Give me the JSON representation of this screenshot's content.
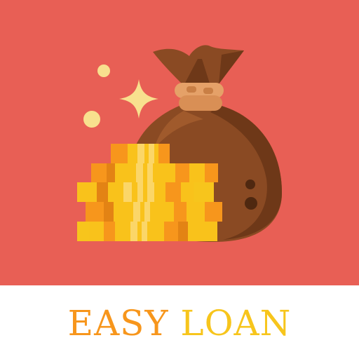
{
  "brand": {
    "word_easy": "EASY",
    "word_loan": "LOAN"
  },
  "colors": {
    "background": "#e85f55",
    "footer_background": "#ffffff",
    "title_easy": "#f7961c",
    "title_loan": "#f7c51c",
    "bag": "#8a4a23",
    "bag_shadow": "#6e3818",
    "bag_tie": "#e5a168",
    "coins": "#f9c21b",
    "sparkle": "#f8e08e"
  },
  "icons": {
    "money_bag": "money-bag-icon",
    "coin_stack": "coin-stack-icon",
    "sparkle": "sparkle-icon"
  }
}
